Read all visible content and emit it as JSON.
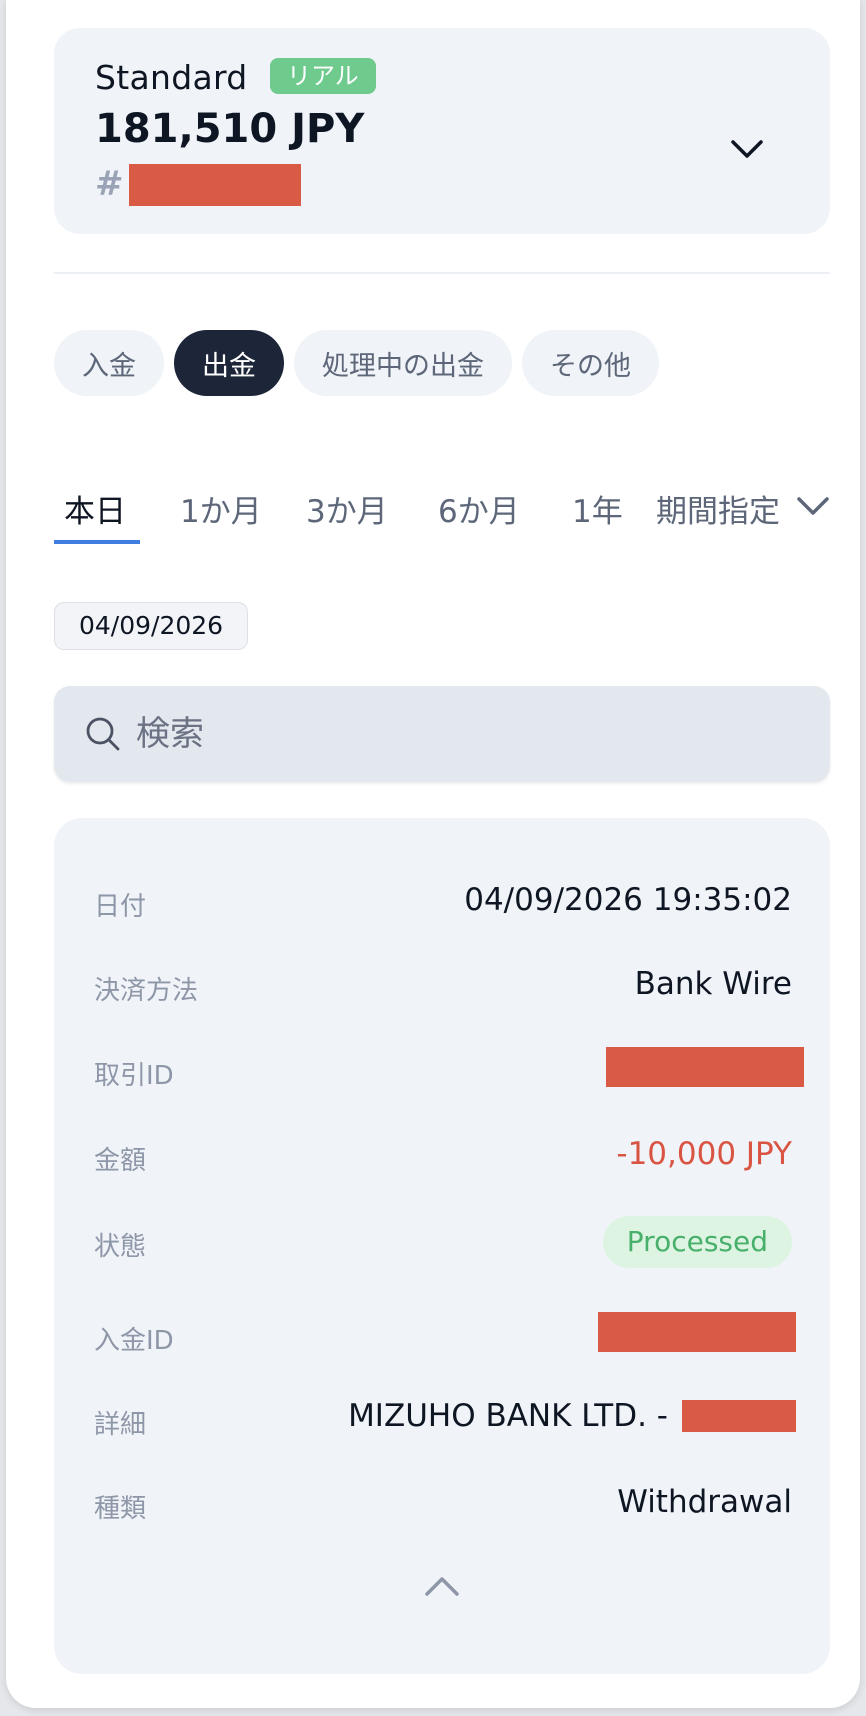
{
  "account": {
    "type": "Standard",
    "badge": "リアル",
    "balance": "181,510 JPY",
    "number_prefix": "#",
    "number_redacted": true
  },
  "tx_type_tabs": [
    {
      "label": "入金",
      "active": false
    },
    {
      "label": "出金",
      "active": true
    },
    {
      "label": "処理中の出金",
      "active": false
    },
    {
      "label": "その他",
      "active": false
    }
  ],
  "period_tabs": [
    {
      "label": "本日",
      "active": true
    },
    {
      "label": "1か月",
      "active": false
    },
    {
      "label": "3か月",
      "active": false
    },
    {
      "label": "6か月",
      "active": false
    },
    {
      "label": "1年",
      "active": false
    },
    {
      "label": "期間指定",
      "active": false
    }
  ],
  "date_chip": "04/09/2026",
  "search": {
    "placeholder": "検索",
    "value": ""
  },
  "transaction": {
    "date_label": "日付",
    "date_value": "04/09/2026 19:35:02",
    "method_label": "決済方法",
    "method_value": "Bank Wire",
    "txid_label": "取引ID",
    "amount_label": "金額",
    "amount_value": "-10,000 JPY",
    "status_label": "状態",
    "status_value": "Processed",
    "depositid_label": "入金ID",
    "detail_label": "詳細",
    "detail_value": "MIZUHO BANK LTD. -",
    "kind_label": "種類",
    "kind_value": "Withdrawal"
  },
  "colors": {
    "accent": "#3f7de0",
    "active_pill": "#1d2638",
    "real_badge": "#6fca8e",
    "negative": "#d95442",
    "processed": "#48b06a",
    "redaction": "#d95a45"
  },
  "icons": {
    "account_toggle": "chevron-down-icon",
    "period_toggle": "chevron-down-icon",
    "search": "search-icon",
    "collapse": "chevron-up-icon"
  }
}
